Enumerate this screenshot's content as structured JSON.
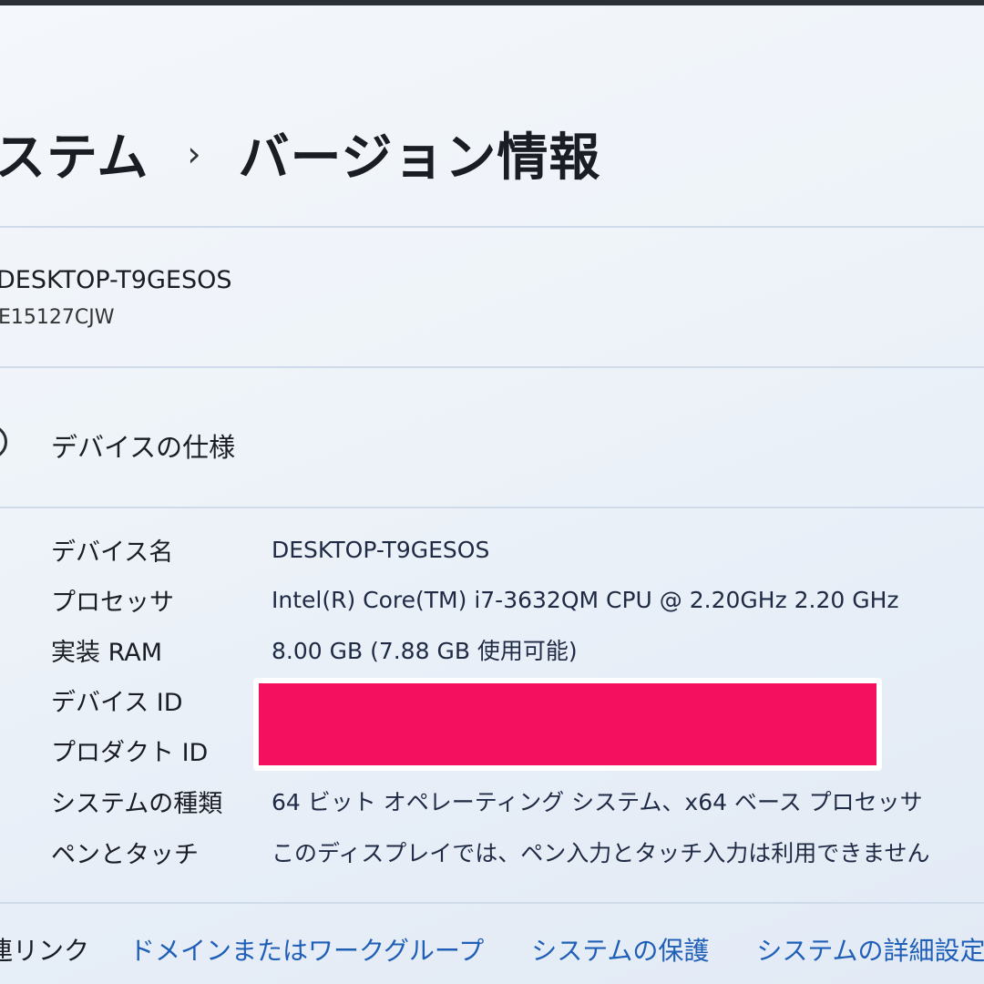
{
  "breadcrumb": {
    "parent": "ステム",
    "separator": "›",
    "current": "バージョン情報"
  },
  "device_summary": {
    "name": "DESKTOP-T9GESOS",
    "model": "E15127CJW"
  },
  "specs_section": {
    "icon": "info-icon",
    "title": "デバイスの仕様",
    "rows": [
      {
        "label": "デバイス名",
        "value": "DESKTOP-T9GESOS"
      },
      {
        "label": "プロセッサ",
        "value": "Intel(R) Core(TM) i7-3632QM CPU @ 2.20GHz   2.20 GHz"
      },
      {
        "label": "実装 RAM",
        "value": "8.00 GB (7.88 GB 使用可能)"
      },
      {
        "label": "デバイス ID",
        "value": ""
      },
      {
        "label": "プロダクト ID",
        "value": ""
      },
      {
        "label": "システムの種類",
        "value": "64 ビット オペレーティング システム、x64 ベース プロセッサ"
      },
      {
        "label": "ペンとタッチ",
        "value": "このディスプレイでは、ペン入力とタッチ入力は利用できません"
      }
    ]
  },
  "redaction_color": "#f5105f",
  "related_links": {
    "label": "連リンク",
    "items": [
      "ドメインまたはワークグループ",
      "システムの保護",
      "システムの詳細設定"
    ]
  }
}
